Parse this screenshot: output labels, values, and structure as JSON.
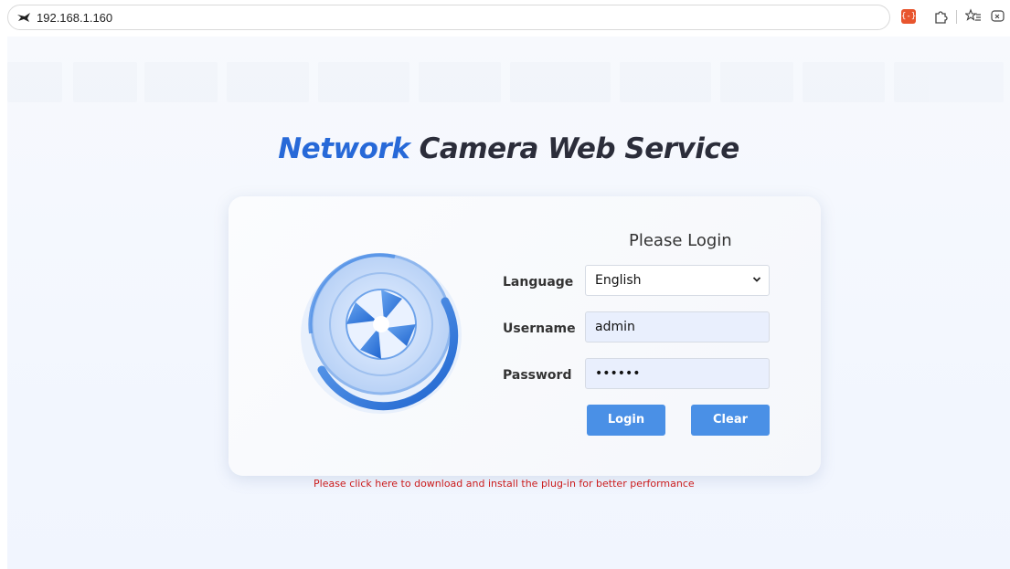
{
  "browser": {
    "url": "192.168.1.160",
    "extension_badge": "{-}"
  },
  "page": {
    "title_accent": "Network",
    "title_rest": " Camera Web Service"
  },
  "login": {
    "heading": "Please Login",
    "language_label": "Language",
    "language_value": "English",
    "username_label": "Username",
    "username_value": "admin",
    "password_label": "Password",
    "password_value": "••••••",
    "login_button": "Login",
    "clear_button": "Clear"
  },
  "plugin_notice": "Please click here to download and install the plug-in for better performance",
  "colors": {
    "accent_blue": "#2769d8",
    "button_blue": "#4a90e6",
    "notice_red": "#cc1d1d"
  },
  "icons": [
    "url-site-icon",
    "extension-icon",
    "extensions-puzzle-icon",
    "favorites-icon",
    "collections-icon",
    "logo-lens-icon"
  ]
}
